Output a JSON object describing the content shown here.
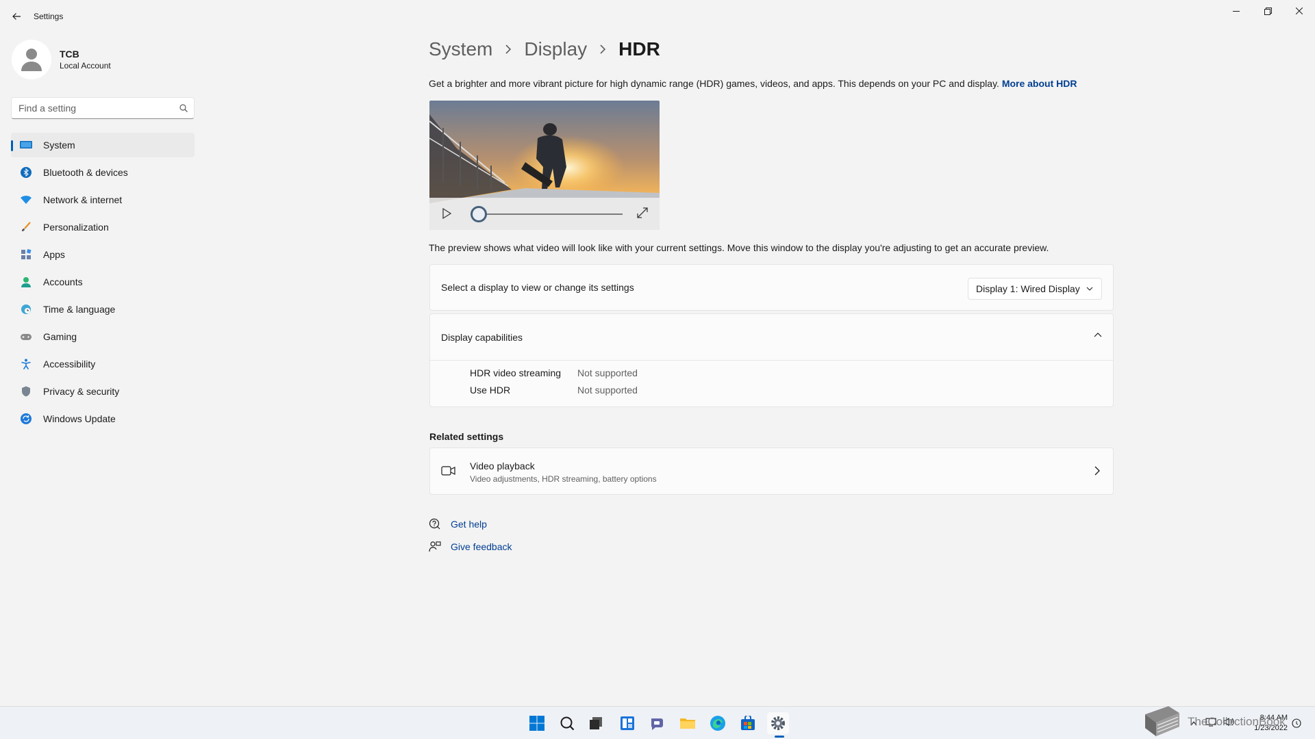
{
  "window": {
    "title": "Settings"
  },
  "profile": {
    "name": "TCB",
    "account_type": "Local Account"
  },
  "search": {
    "placeholder": "Find a setting"
  },
  "sidebar": {
    "items": [
      {
        "label": "System",
        "icon": "monitor-icon",
        "active": true
      },
      {
        "label": "Bluetooth & devices",
        "icon": "bluetooth-icon"
      },
      {
        "label": "Network & internet",
        "icon": "wifi-icon"
      },
      {
        "label": "Personalization",
        "icon": "brush-icon"
      },
      {
        "label": "Apps",
        "icon": "apps-icon"
      },
      {
        "label": "Accounts",
        "icon": "person-icon"
      },
      {
        "label": "Time & language",
        "icon": "globe-clock-icon"
      },
      {
        "label": "Gaming",
        "icon": "gamepad-icon"
      },
      {
        "label": "Accessibility",
        "icon": "accessibility-icon"
      },
      {
        "label": "Privacy & security",
        "icon": "shield-icon"
      },
      {
        "label": "Windows Update",
        "icon": "update-icon"
      }
    ]
  },
  "breadcrumb": {
    "level1": "System",
    "level2": "Display",
    "current": "HDR"
  },
  "intro": {
    "text": "Get a brighter and more vibrant picture for high dynamic range (HDR) games, videos, and apps. This depends on your PC and display. ",
    "link": "More about HDR"
  },
  "video_preview": {
    "progress": 0
  },
  "preview_note": "The preview shows what video will look like with your current settings. Move this window to the display you're adjusting to get an accurate preview.",
  "display_select": {
    "label": "Select a display to view or change its settings",
    "value": "Display 1: Wired Display"
  },
  "capabilities": {
    "title": "Display capabilities",
    "rows": [
      {
        "key": "HDR video streaming",
        "value": "Not supported"
      },
      {
        "key": "Use HDR",
        "value": "Not supported"
      }
    ]
  },
  "related": {
    "title": "Related settings",
    "video_playback": {
      "title": "Video playback",
      "subtitle": "Video adjustments, HDR streaming, battery options"
    }
  },
  "help": {
    "get_help": "Get help",
    "give_feedback": "Give feedback"
  },
  "clock": {
    "time": "8:44 AM",
    "date": "1/23/2022"
  },
  "watermark": "TheCollectionBook",
  "colors": {
    "accent": "#005fb8",
    "link": "#003e92"
  }
}
